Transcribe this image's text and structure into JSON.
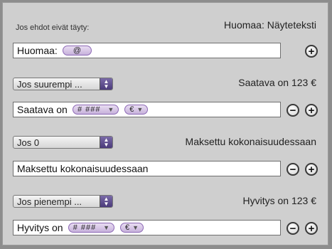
{
  "header": {
    "condition_label": "Jos ehdot eivät täyty:",
    "note": "Huomaa: Näyteteksti"
  },
  "default_field": {
    "text": "Huomaa:",
    "token": "@"
  },
  "rules": [
    {
      "condition": "Jos suurempi ...",
      "result_label": "Saatava on 123 €",
      "text": "Saatava on",
      "number_format": "# ###",
      "currency": "€"
    },
    {
      "condition": "Jos 0",
      "result_label": "Maksettu kokonaisuudessaan",
      "text": "Maksettu kokonaisuudessaan"
    },
    {
      "condition": "Jos pienempi ...",
      "result_label": "Hyvitys on 123 €",
      "text": "Hyvitys on",
      "number_format": "# ###",
      "currency": "€"
    }
  ],
  "buttons": {
    "add": "+",
    "remove": "−"
  },
  "icons": {
    "add": "plus-icon",
    "remove": "minus-icon",
    "dropdown": "chevron-down-icon",
    "select": "up-down-arrows-icon"
  }
}
